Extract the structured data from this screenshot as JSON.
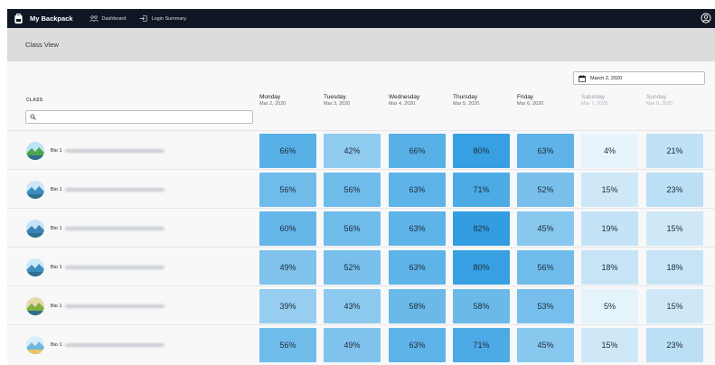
{
  "app": {
    "title": "My Backpack"
  },
  "nav": [
    {
      "label": "Dashboard",
      "icon": "users-icon"
    },
    {
      "label": "Login Summary",
      "icon": "login-icon"
    }
  ],
  "page": {
    "title": "Class View"
  },
  "date_picker": {
    "value": "March 2, 2020",
    "icon": "calendar-icon"
  },
  "class_column": {
    "label": "CLASS",
    "search_placeholder": ""
  },
  "days": [
    {
      "name": "Monday",
      "date": "Mar 2, 2020",
      "weekend": false
    },
    {
      "name": "Tuesday",
      "date": "Mar 3, 2020",
      "weekend": false
    },
    {
      "name": "Wednesday",
      "date": "Mar 4, 2020",
      "weekend": false
    },
    {
      "name": "Thursday",
      "date": "Mar 5, 2020",
      "weekend": false
    },
    {
      "name": "Friday",
      "date": "Mar 6, 2020",
      "weekend": false
    },
    {
      "name": "Saturday",
      "date": "Mar 7, 2020",
      "weekend": true
    },
    {
      "name": "Sunday",
      "date": "Mar 8, 2020",
      "weekend": true
    }
  ],
  "rows": [
    {
      "class": "Bio 1",
      "values": [
        "66%",
        "42%",
        "66%",
        "80%",
        "63%",
        "4%",
        "21%"
      ]
    },
    {
      "class": "Bio 1",
      "values": [
        "56%",
        "56%",
        "63%",
        "71%",
        "52%",
        "15%",
        "23%"
      ]
    },
    {
      "class": "Bio 1",
      "values": [
        "60%",
        "56%",
        "63%",
        "82%",
        "45%",
        "19%",
        "15%"
      ]
    },
    {
      "class": "Bio 1",
      "values": [
        "49%",
        "52%",
        "63%",
        "80%",
        "56%",
        "18%",
        "18%"
      ]
    },
    {
      "class": "Bio 1",
      "values": [
        "39%",
        "43%",
        "58%",
        "58%",
        "53%",
        "5%",
        "15%"
      ]
    },
    {
      "class": "Bio 1",
      "values": [
        "56%",
        "49%",
        "63%",
        "71%",
        "45%",
        "15%",
        "23%"
      ]
    }
  ],
  "colors": {
    "topbar": "#0f1724",
    "cell_low": "#f1f8fd",
    "cell_high": "#2b9be0"
  }
}
